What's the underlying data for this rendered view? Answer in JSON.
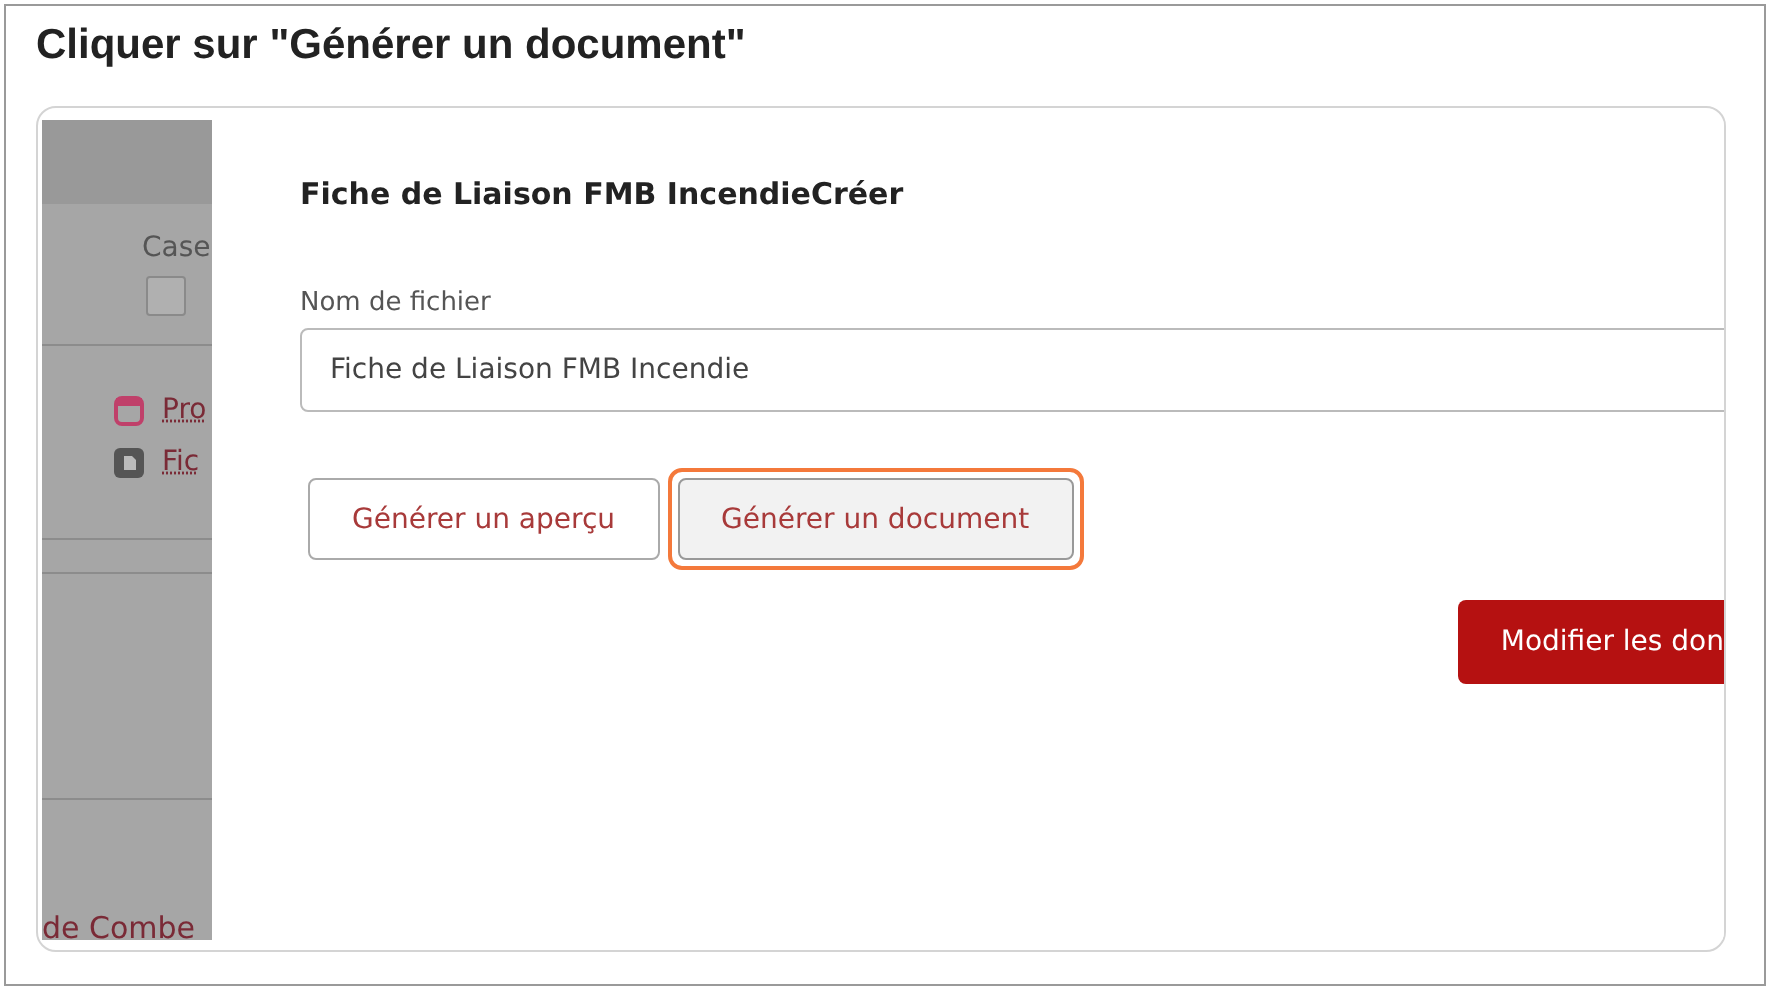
{
  "instruction": "Cliquer sur \"Générer un document\"",
  "background_page": {
    "column_header": "Case",
    "checkbox": {
      "checked": false
    },
    "links": [
      {
        "label": "Pro",
        "kind": "calendar"
      },
      {
        "label": "Fic",
        "kind": "document"
      }
    ],
    "footer_link": "de Combe"
  },
  "dialog": {
    "title": "Fiche de Liaison FMB IncendieCréer",
    "field": {
      "label": "Nom de fichier",
      "value": "Fiche de Liaison FMB Incendie"
    },
    "buttons": [
      {
        "label": "Générer un aperçu",
        "highlighted": false
      },
      {
        "label": "Générer un document",
        "highlighted": true
      }
    ],
    "primary_button": "Modifier les don"
  }
}
